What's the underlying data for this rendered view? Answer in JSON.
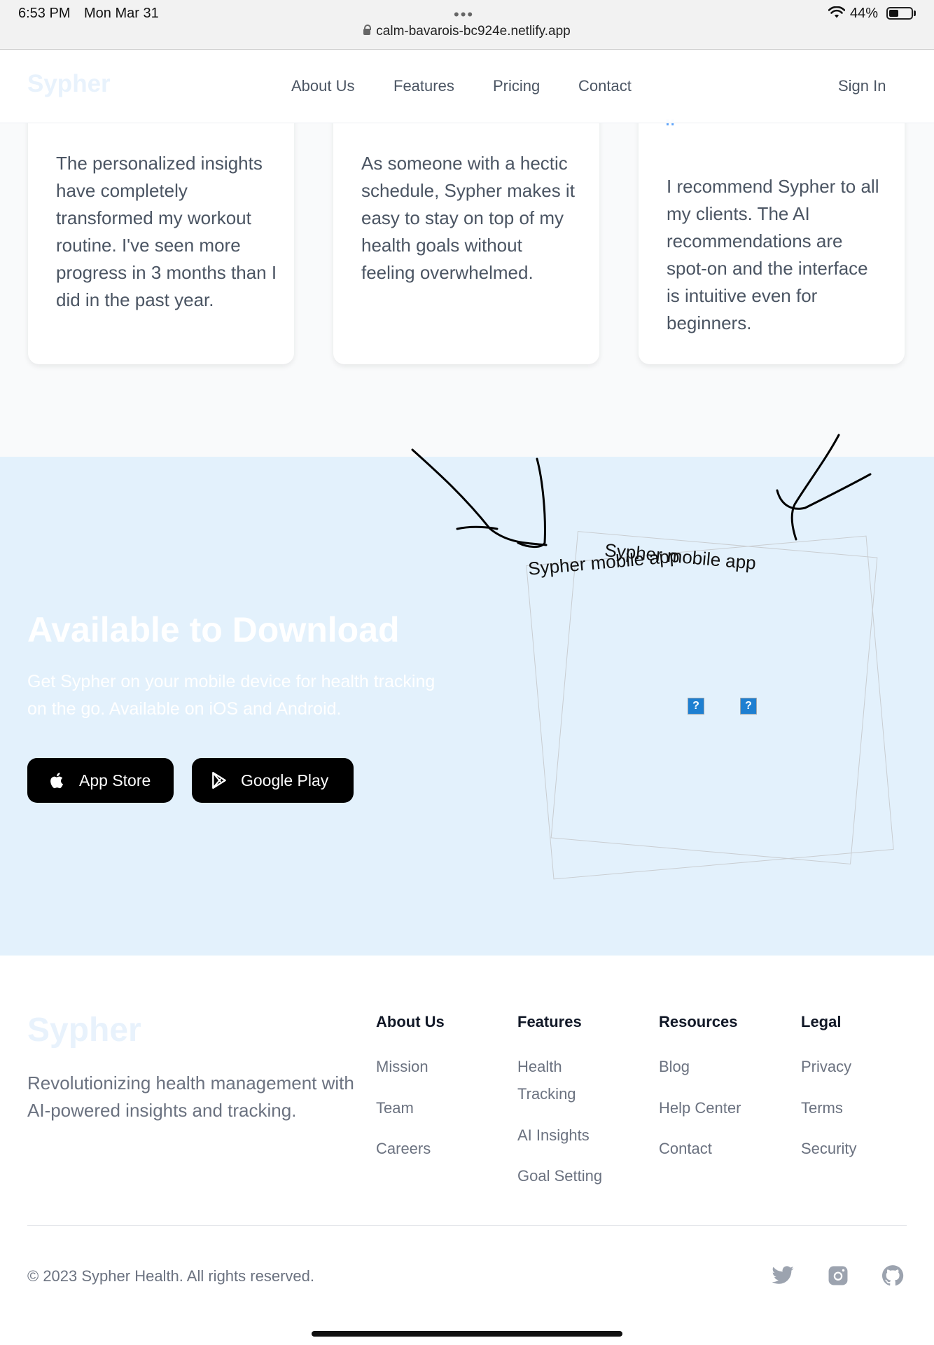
{
  "status_bar": {
    "time": "6:53 PM",
    "date": "Mon Mar 31",
    "dots": "•••",
    "url": "calm-bavarois-bc924e.netlify.app",
    "battery": "44%",
    "battery_level": 0.44
  },
  "nav": {
    "brand": "Sypher",
    "links": [
      "About Us",
      "Features",
      "Pricing",
      "Contact"
    ],
    "sign_in": "Sign In"
  },
  "testimonials": [
    {
      "quote": "The personalized insights have completely transformed my workout routine. I've seen more progress in 3 months than I did in the past year."
    },
    {
      "quote": "As someone with a hectic schedule, Sypher makes it easy to stay on top of my health goals without feeling overwhelmed."
    },
    {
      "quote_mark": "\"",
      "quote": "I recommend Sypher to all my clients. The AI recommendations are spot-on and the interface is intuitive even for beginners."
    }
  ],
  "download": {
    "title": "Available to Download",
    "description": "Get Sypher on your mobile device for health tracking on the go. Available on iOS and Android.",
    "app_store_label": "App Store",
    "google_play_label": "Google Play",
    "app_image_alt_1": "Sypher mobile app",
    "app_image_alt_2": "Sypher mobile app",
    "broken_image_glyph": "?"
  },
  "footer": {
    "brand": "Sypher",
    "tagline": "Revolutionizing health management with AI-powered insights and tracking.",
    "columns": [
      {
        "heading": "About Us",
        "links": [
          "Mission",
          "Team",
          "Careers"
        ]
      },
      {
        "heading": "Features",
        "links": [
          "Health Tracking",
          "AI Insights",
          "Goal Setting"
        ]
      },
      {
        "heading": "Resources",
        "links": [
          "Blog",
          "Help Center",
          "Contact"
        ]
      },
      {
        "heading": "Legal",
        "links": [
          "Privacy",
          "Terms",
          "Security"
        ]
      }
    ],
    "copyright": "© 2023 Sypher Health. All rights reserved.",
    "social_icons": [
      "twitter-icon",
      "instagram-icon",
      "github-icon"
    ]
  }
}
